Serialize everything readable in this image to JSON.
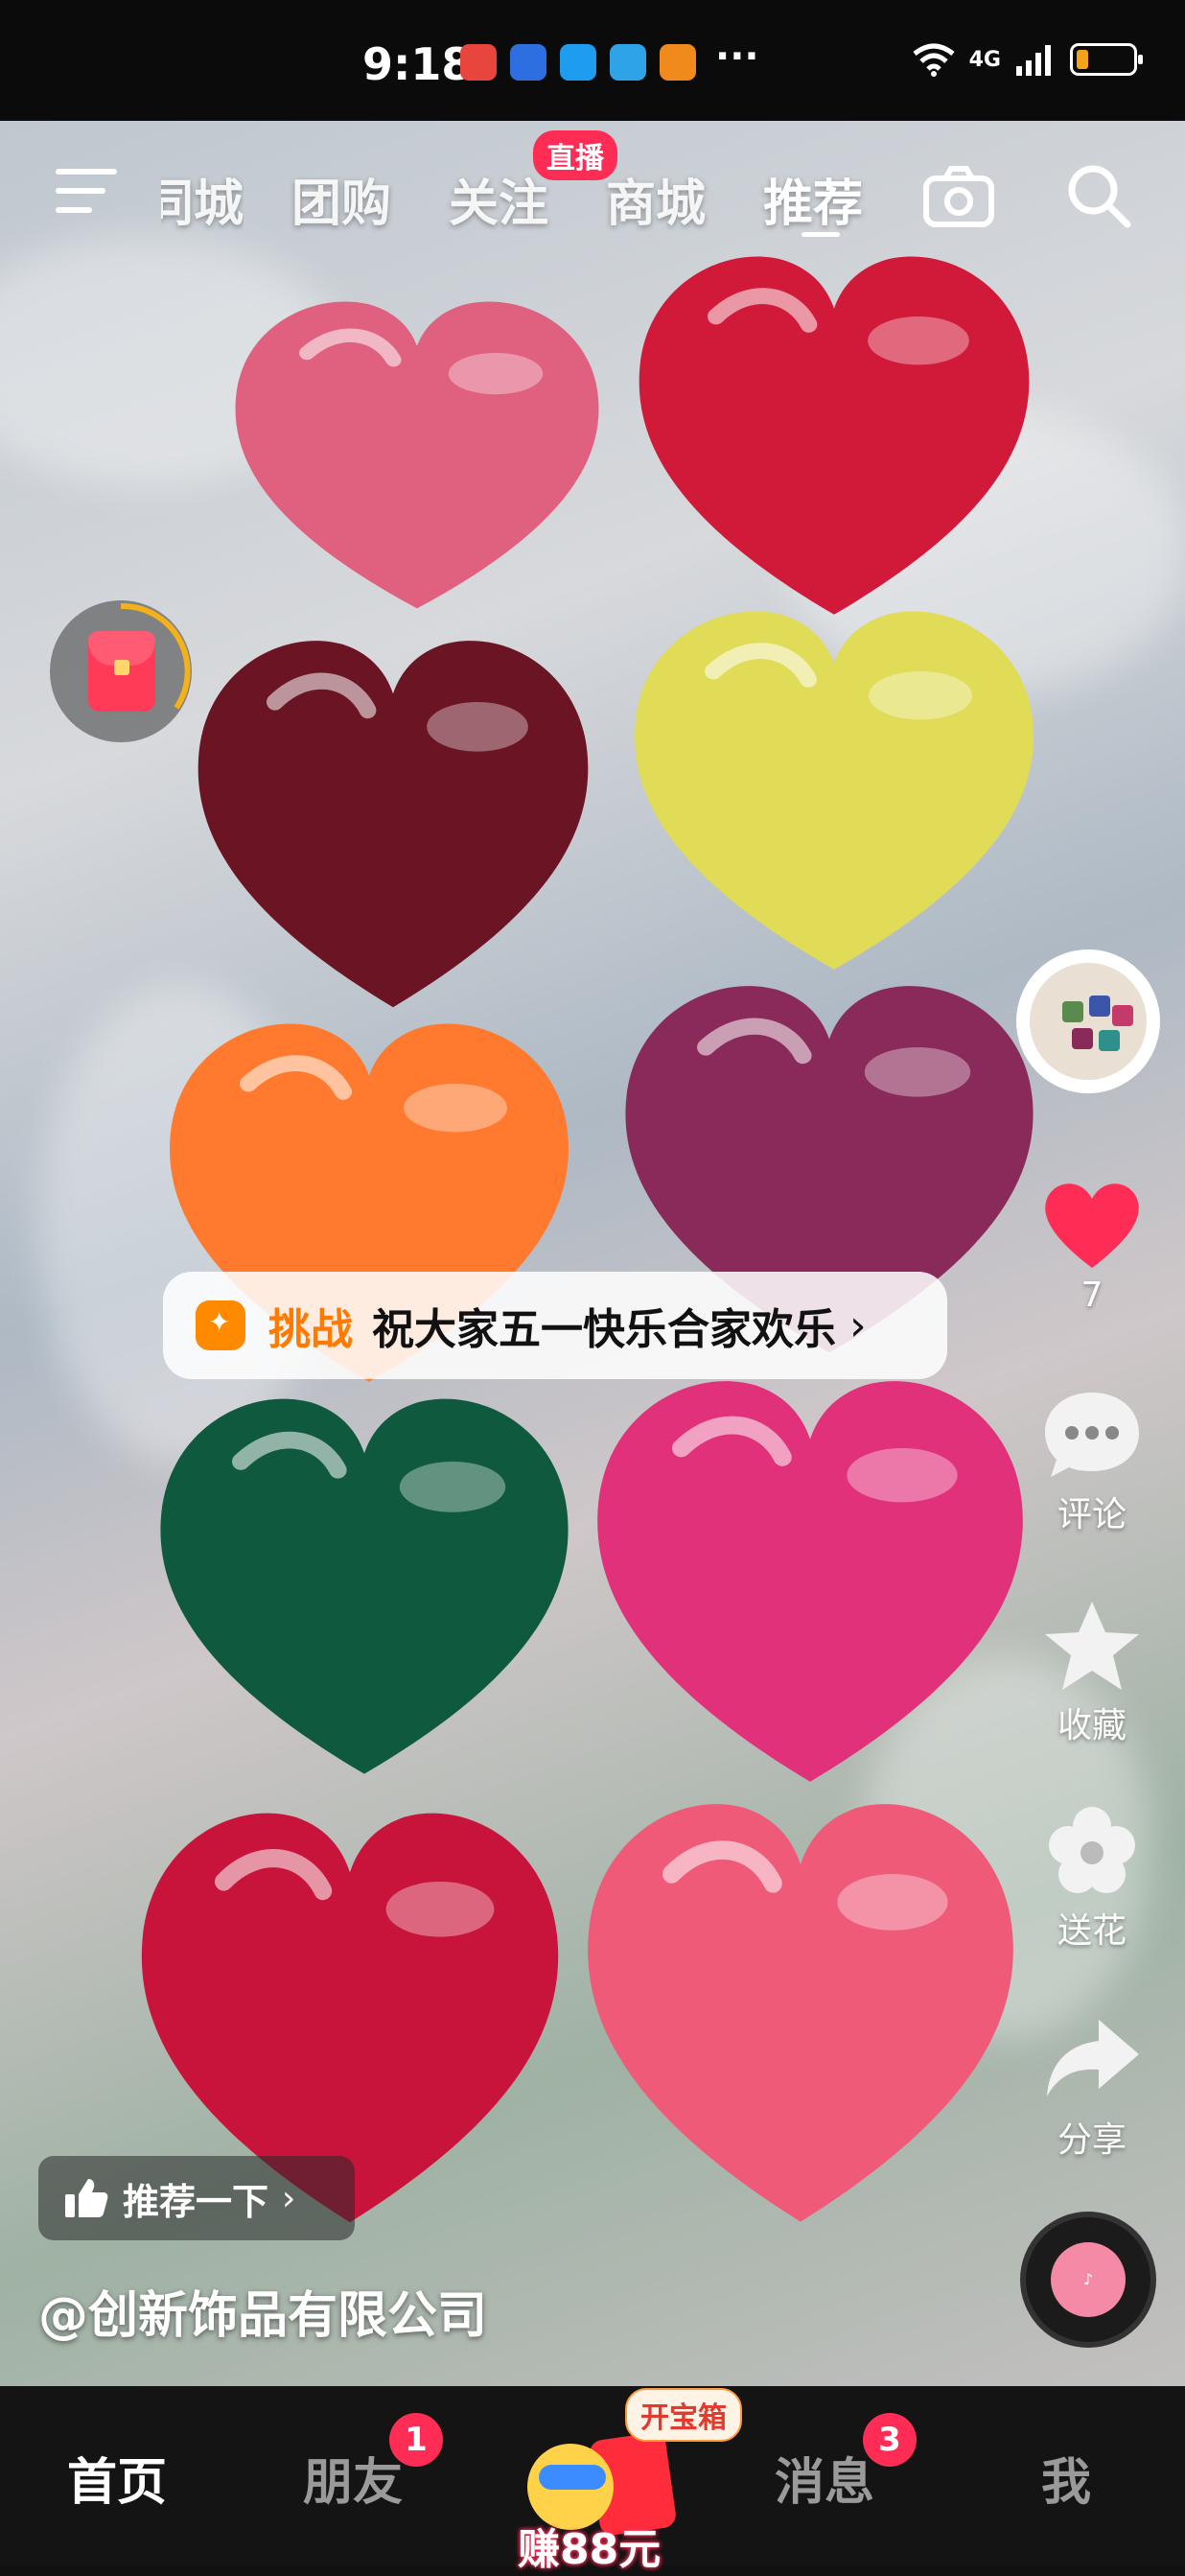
{
  "status_bar": {
    "time": "9:18",
    "more": "···",
    "network": "4G"
  },
  "top_nav": {
    "tabs": [
      {
        "label": "同城"
      },
      {
        "label": "团购"
      },
      {
        "label": "关注"
      },
      {
        "label": "商城"
      },
      {
        "label": "推荐"
      }
    ],
    "live_badge": "直播",
    "active_tab": "推荐"
  },
  "challenge": {
    "tag": "挑战",
    "text": "祝大家五一快乐合家欢乐",
    "arrow": "›"
  },
  "side_actions": {
    "like_count": "7",
    "comment_label": "评论",
    "favorite_label": "收藏",
    "flower_label": "送花",
    "share_label": "分享"
  },
  "recommend": {
    "label": "推荐一下",
    "arrow": "›"
  },
  "author": "@创新饰品有限公司",
  "bottom_nav": {
    "home": "首页",
    "friends": "朋友",
    "friends_badge": "1",
    "earn_tag": "开宝箱",
    "earn_label": "赚88元",
    "messages": "消息",
    "messages_badge": "3",
    "me": "我"
  },
  "colors": {
    "accent": "#ff2d55",
    "challenge": "#ff7a00"
  },
  "hearts": [
    {
      "color": "#e0607f"
    },
    {
      "color": "#d11a3a"
    },
    {
      "color": "#6b1524"
    },
    {
      "color": "#e0dc58"
    },
    {
      "color": "#ff7a2e"
    },
    {
      "color": "#8a2a5a"
    },
    {
      "color": "#0f5a3e"
    },
    {
      "color": "#e0317a"
    },
    {
      "color": "#c8143a"
    },
    {
      "color": "#ee5a78"
    }
  ]
}
